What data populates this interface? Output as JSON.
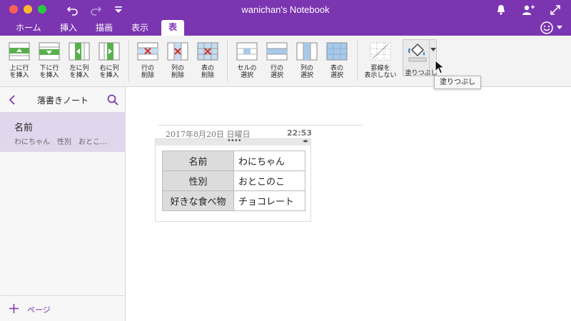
{
  "window": {
    "title": "wanichan's Notebook"
  },
  "tabs": [
    {
      "label": "ホーム"
    },
    {
      "label": "挿入"
    },
    {
      "label": "描画"
    },
    {
      "label": "表示"
    },
    {
      "label": "表",
      "active": true
    }
  ],
  "ribbon": {
    "insert_row_above": "上に行\nを挿入",
    "insert_row_below": "下に行\nを挿入",
    "insert_col_left": "左に列\nを挿入",
    "insert_col_right": "右に列\nを挿入",
    "delete_row": "行の\n削除",
    "delete_col": "列の\n削除",
    "delete_table": "表の\n削除",
    "select_cell": "セルの\n選択",
    "select_row": "行の\n選択",
    "select_col": "列の\n選択",
    "select_table": "表の\n選択",
    "hide_borders": "罫線を\n表示しない",
    "shading": "塗りつぶし"
  },
  "tooltip": "塗りつぶし",
  "sidebar": {
    "title": "落書きノート",
    "pages": [
      {
        "title": "名前",
        "preview": "わにちゃん　性別　おとこ…"
      }
    ],
    "add_page": "ページ"
  },
  "note": {
    "date": "2017年8月20日 日曜日",
    "time": "22:53",
    "table": [
      [
        "名前",
        "わにちゃん"
      ],
      [
        "性別",
        "おとこのこ"
      ],
      [
        "好きな食べ物",
        "チョコレート"
      ]
    ]
  },
  "colors": {
    "accent": "#7B35B1",
    "selected_page": "#E2D6EC",
    "header_cell": "#DCDCDC"
  }
}
